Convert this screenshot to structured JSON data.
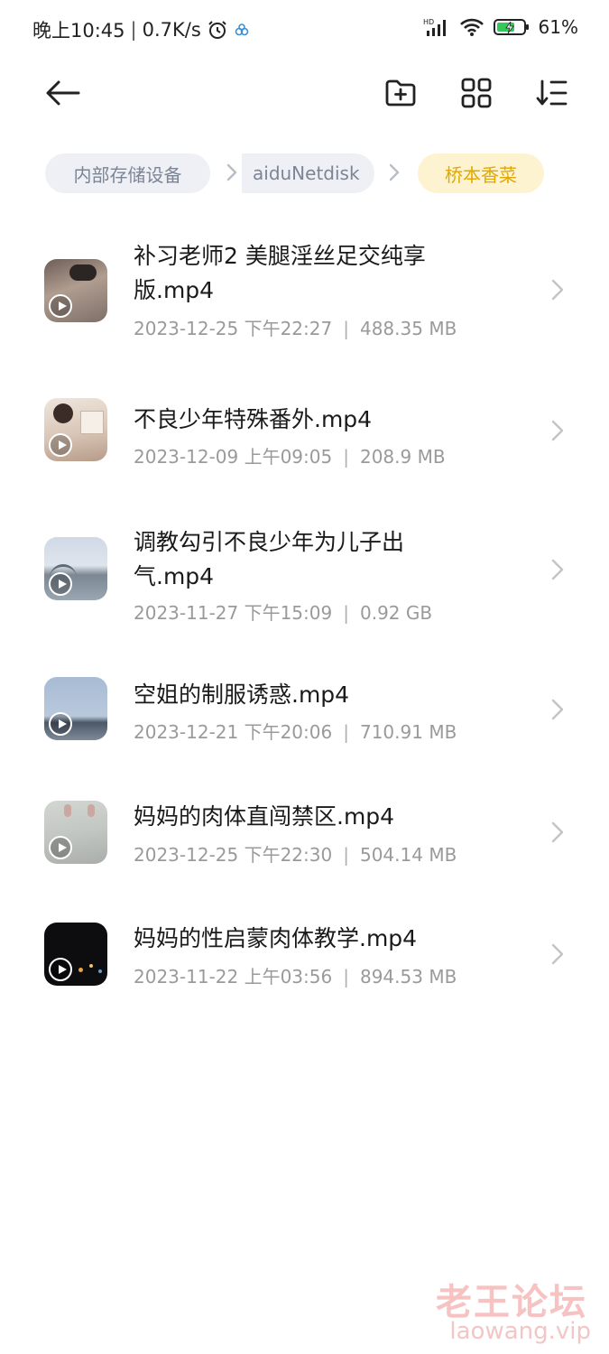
{
  "status_bar": {
    "time": "晚上10:45",
    "net_speed": "0.7K/s",
    "battery": "61%"
  },
  "breadcrumb": {
    "items": [
      {
        "label": "内部存储设备"
      },
      {
        "label": "aiduNetdisk"
      },
      {
        "label": "桥本香菜"
      }
    ]
  },
  "files": [
    {
      "name": "补习老师2 美腿淫丝足交纯享版.mp4",
      "date": "2023-12-25 下午22:27",
      "size": "488.35 MB"
    },
    {
      "name": "不良少年特殊番外.mp4",
      "date": "2023-12-09 上午09:05",
      "size": "208.9 MB"
    },
    {
      "name": "调教勾引不良少年为儿子出气.mp4",
      "date": "2023-11-27 下午15:09",
      "size": "0.92 GB"
    },
    {
      "name": "空姐的制服诱惑.mp4",
      "date": "2023-12-21 下午20:06",
      "size": "710.91 MB"
    },
    {
      "name": "妈妈的肉体直闯禁区.mp4",
      "date": "2023-12-25 下午22:30",
      "size": "504.14 MB"
    },
    {
      "name": "妈妈的性启蒙肉体教学.mp4",
      "date": "2023-11-22 上午03:56",
      "size": "894.53 MB"
    }
  ],
  "watermark": {
    "title": "老王论坛",
    "url": "laowang.vip"
  },
  "colors": {
    "accent": "#e0a800",
    "active_crumb_bg": "#fdf3d0",
    "crumb_bg": "#eef0f5"
  }
}
